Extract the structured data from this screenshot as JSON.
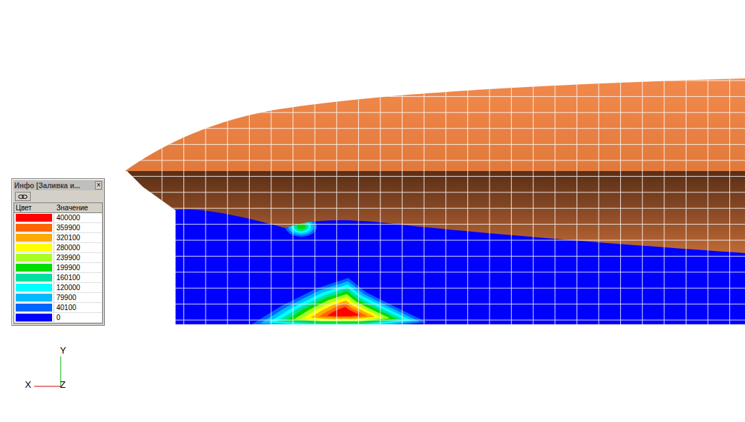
{
  "info_window": {
    "title": "Инфо [Заливка и...",
    "close": "×",
    "columns": [
      "Цвет",
      "Значение"
    ],
    "rows": [
      {
        "value": "400000",
        "color": "#ff0000"
      },
      {
        "value": "359900",
        "color": "#ff6600"
      },
      {
        "value": "320100",
        "color": "#ffaa00"
      },
      {
        "value": "280000",
        "color": "#ffff00"
      },
      {
        "value": "239900",
        "color": "#aaff22"
      },
      {
        "value": "199900",
        "color": "#00dd00"
      },
      {
        "value": "160100",
        "color": "#00e0a0"
      },
      {
        "value": "120000",
        "color": "#00ffff"
      },
      {
        "value": "79900",
        "color": "#00bbff"
      },
      {
        "value": "40100",
        "color": "#0066ff"
      },
      {
        "value": "0",
        "color": "#0000ff"
      }
    ]
  },
  "axes": {
    "y": "Y",
    "x": "X",
    "z": "Z"
  }
}
